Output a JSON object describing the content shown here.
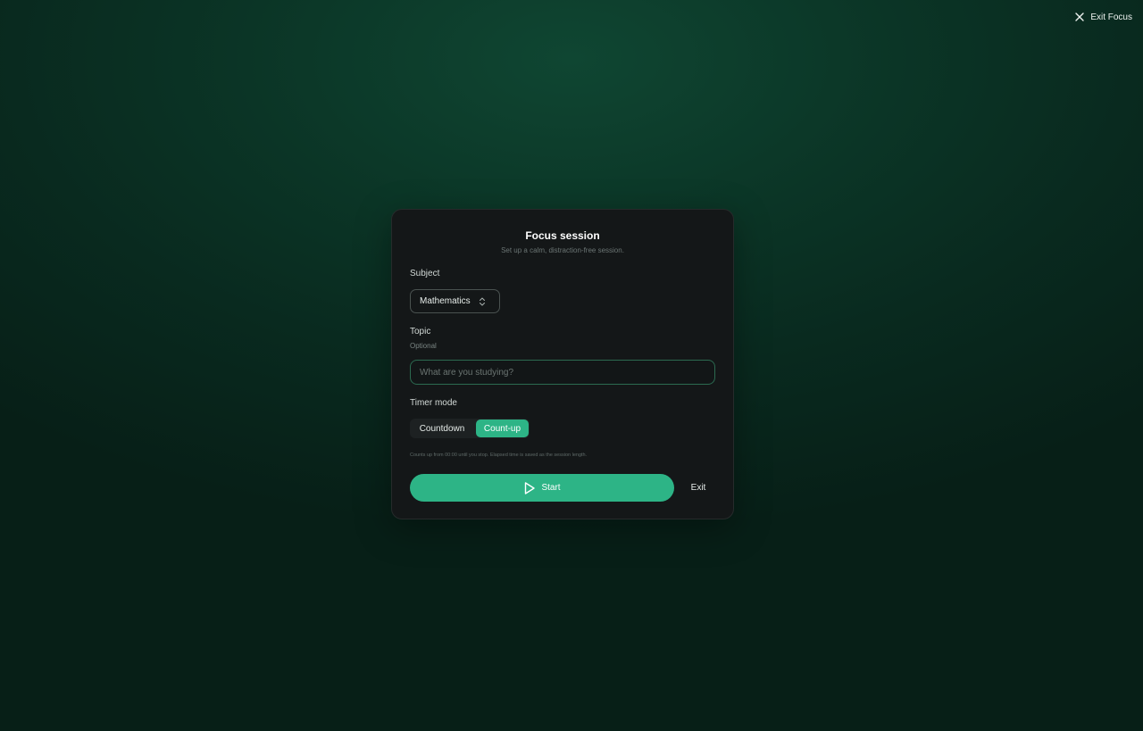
{
  "header": {
    "exit_focus_label": "Exit Focus",
    "exit_icon": "close-icon"
  },
  "card": {
    "title": "Focus session",
    "subtitle": "Set up a calm, distraction-free session."
  },
  "subject": {
    "label": "Subject",
    "selected": "Mathematics",
    "icon": "chevron-up-down-icon"
  },
  "topic": {
    "label": "Topic",
    "hint": "Optional",
    "placeholder": "What are you studying?",
    "value": ""
  },
  "timer_mode": {
    "label": "Timer mode",
    "options": [
      "Countdown",
      "Count-up"
    ],
    "selected": "Count-up",
    "hint": "Counts up from 00:00 until you stop. Elapsed time is saved as the session length."
  },
  "actions": {
    "start_label": "Start",
    "start_icon": "play-icon",
    "exit_label": "Exit"
  },
  "colors": {
    "accent": "#2db486",
    "card_bg": "#141718",
    "background": "#0b3526"
  }
}
